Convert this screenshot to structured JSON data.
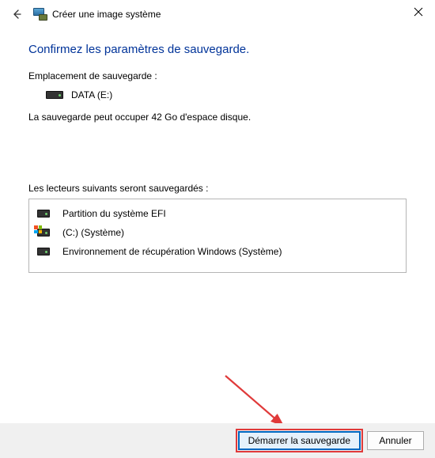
{
  "window": {
    "title": "Créer une image système"
  },
  "page": {
    "heading": "Confirmez les paramètres de sauvegarde.",
    "location_label": "Emplacement de sauvegarde :",
    "destination_drive": "DATA (E:)",
    "size_info": "La sauvegarde peut occuper 42 Go d'espace disque.",
    "drives_label": "Les lecteurs suivants seront sauvegardés :",
    "drives": [
      {
        "label": "Partition du système EFI"
      },
      {
        "label": "(C:) (Système)"
      },
      {
        "label": "Environnement de récupération Windows (Système)"
      }
    ]
  },
  "buttons": {
    "start": "Démarrer la sauvegarde",
    "cancel": "Annuler"
  }
}
